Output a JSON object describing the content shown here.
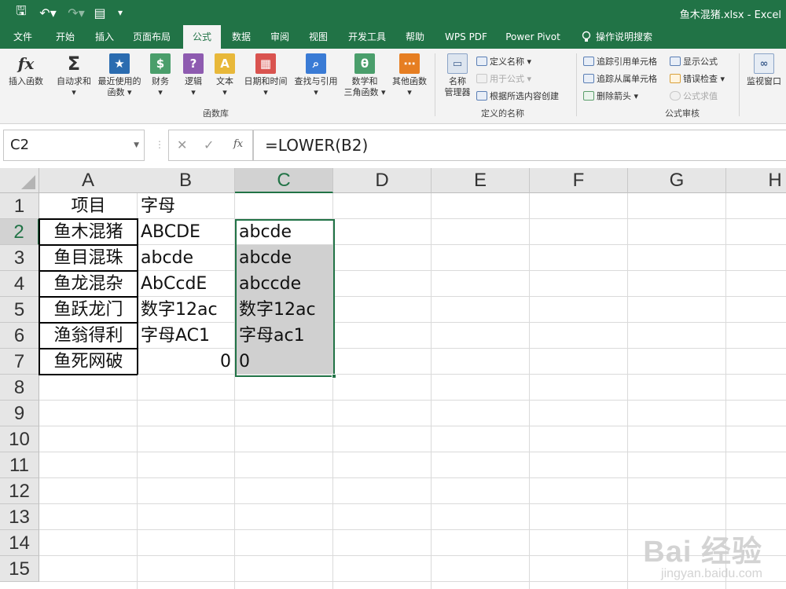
{
  "window": {
    "title": "鱼木混猪.xlsx  -  Excel"
  },
  "colors": {
    "accent": "#217346",
    "selection_fill": "#d0d0d0"
  },
  "quick_access": [
    {
      "name": "save-icon",
      "glyph": "🖫"
    },
    {
      "name": "undo-icon",
      "glyph": "↶▾"
    },
    {
      "name": "redo-icon",
      "glyph": "↷▾"
    },
    {
      "name": "form-icon",
      "glyph": "▤"
    },
    {
      "name": "customize-icon",
      "glyph": "▾"
    }
  ],
  "tabs": [
    "文件",
    "开始",
    "插入",
    "页面布局",
    "公式",
    "数据",
    "审阅",
    "视图",
    "开发工具",
    "帮助",
    "WPS PDF",
    "Power Pivot",
    "操作说明搜索"
  ],
  "active_tab": "公式",
  "ribbon": {
    "function_library": {
      "group_label": "函数库",
      "buttons": [
        {
          "label": "插入函数",
          "label2": "",
          "glyph": "fx",
          "color": "#ffffff"
        },
        {
          "label": "自动求和",
          "label2": "▾",
          "glyph": "Σ",
          "color": "#ffffff"
        },
        {
          "label": "最近使用的",
          "label2": "函数 ▾",
          "glyph": "★",
          "color": "#2b6cb0"
        },
        {
          "label": "财务",
          "label2": "▾",
          "glyph": "$",
          "color": "#4a9e6b"
        },
        {
          "label": "逻辑",
          "label2": "▾",
          "glyph": "?",
          "color": "#8e5bb0"
        },
        {
          "label": "文本",
          "label2": "▾",
          "glyph": "A",
          "color": "#e8b83a"
        },
        {
          "label": "日期和时间",
          "label2": "▾",
          "glyph": "▦",
          "color": "#d9534f"
        },
        {
          "label": "查找与引用",
          "label2": "▾",
          "glyph": "⌕",
          "color": "#3a7bd5"
        },
        {
          "label": "数学和",
          "label2": "三角函数 ▾",
          "glyph": "θ",
          "color": "#4a9e6b"
        },
        {
          "label": "其他函数",
          "label2": "▾",
          "glyph": "⋯",
          "color": "#e67e22"
        }
      ]
    },
    "defined_names": {
      "group_label": "定义的名称",
      "manager_label": "名称",
      "manager_label2": "管理器",
      "define_name": "定义名称 ▾",
      "use_in_formula": "用于公式 ▾",
      "create_from_selection": "根据所选内容创建"
    },
    "formula_auditing": {
      "group_label": "公式审核",
      "trace_precedents": "追踪引用单元格",
      "trace_dependents": "追踪从属单元格",
      "remove_arrows": "删除箭头 ▾",
      "show_formulas": "显示公式",
      "error_checking": "错误检查 ▾",
      "evaluate_formula": "公式求值",
      "watch_window": "监视窗口"
    }
  },
  "formula_bar": {
    "name_box": "C2",
    "formula": "=LOWER(B2)",
    "cancel_glyph": "✕",
    "enter_glyph": "✓",
    "fx_glyph": "fx"
  },
  "sheet": {
    "columns": [
      "A",
      "B",
      "C",
      "D",
      "E",
      "F",
      "G",
      "H"
    ],
    "rows": [
      "1",
      "2",
      "3",
      "4",
      "5",
      "6",
      "7",
      "8",
      "9",
      "10",
      "11",
      "12",
      "13",
      "14",
      "15"
    ],
    "selected_column": "C",
    "selected_row": "2",
    "cells": {
      "A": [
        "项目",
        "鱼木混猪",
        "鱼目混珠",
        "鱼龙混杂",
        "鱼跃龙门",
        "渔翁得利",
        "鱼死网破"
      ],
      "B": [
        "字母",
        "ABCDE",
        "abcde",
        "AbCcdE",
        "数字12ac",
        "字母AC1",
        "0"
      ],
      "C": [
        "",
        "abcde",
        "abcde",
        "abccde",
        "数字12ac",
        "字母ac1",
        "0"
      ]
    }
  },
  "watermark": {
    "main": "Bai 经验",
    "sub": "jingyan.baidu.com"
  }
}
